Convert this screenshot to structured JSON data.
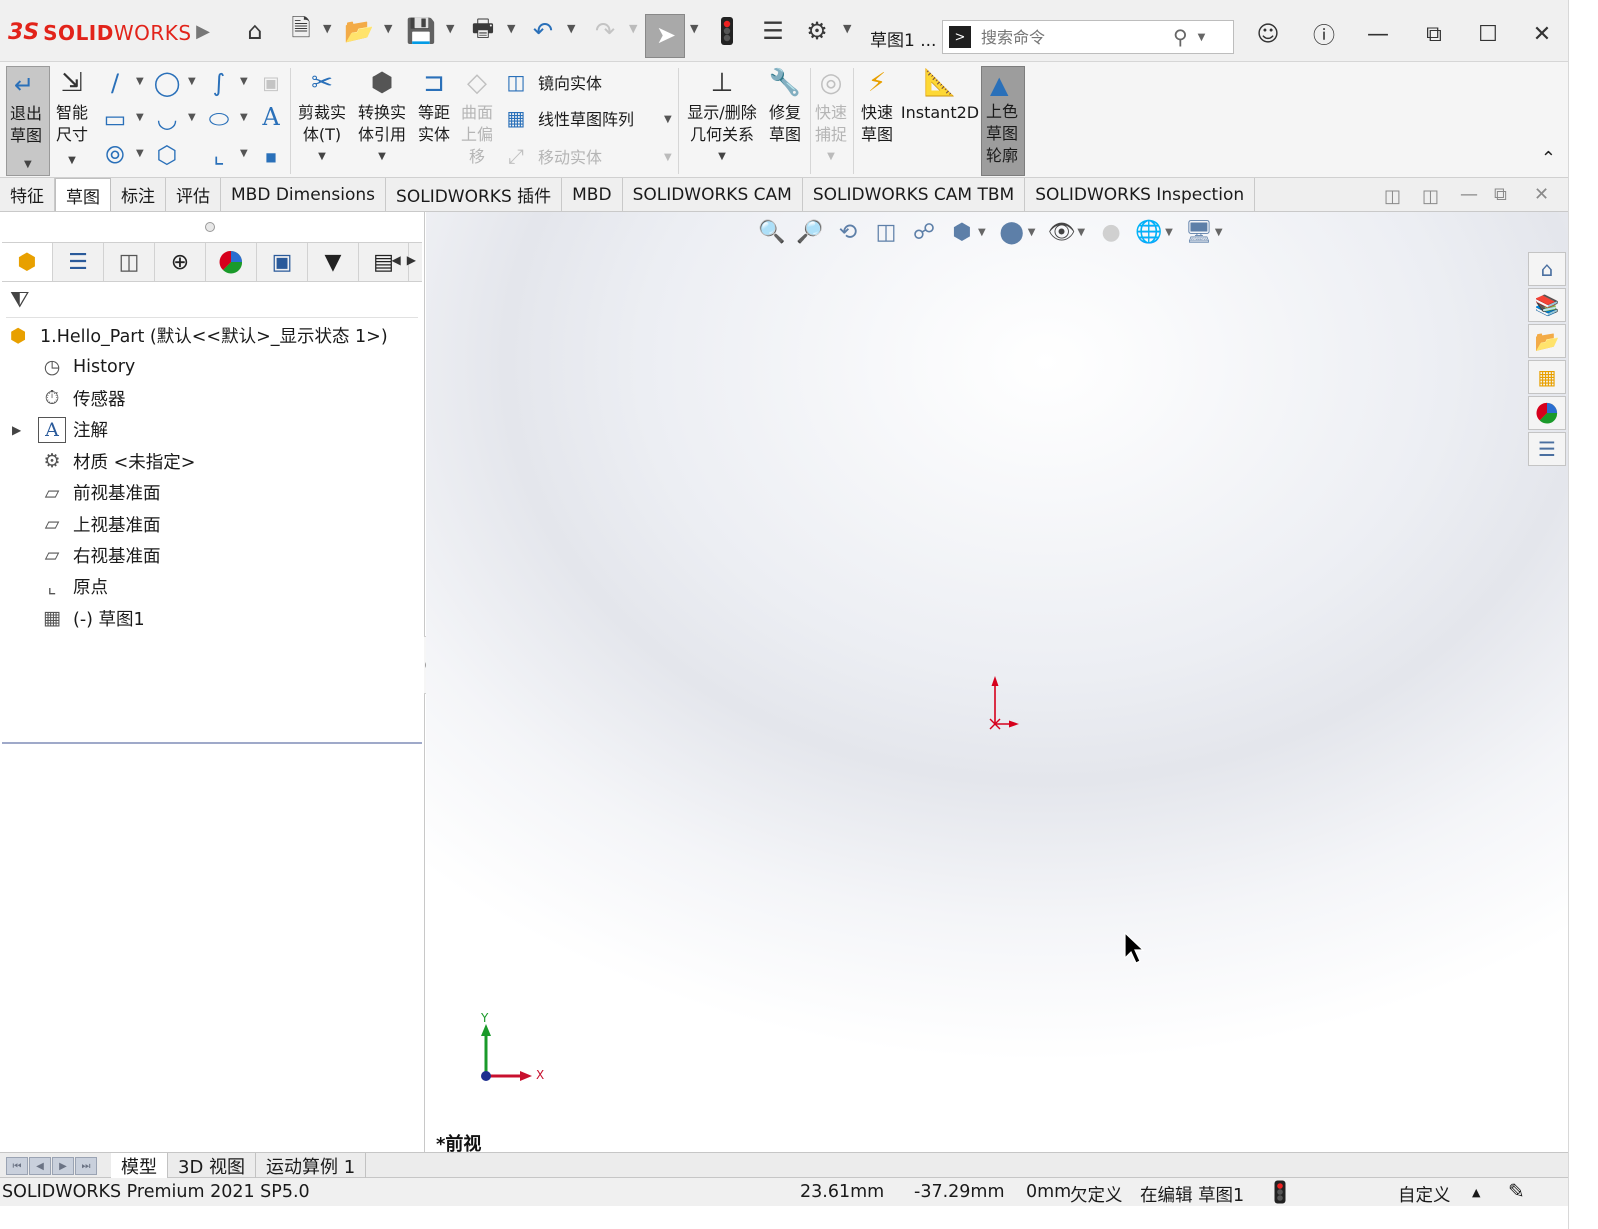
{
  "app": {
    "brand_ds": "3S",
    "brand_solid": "SOLID",
    "brand_works": "WORKS",
    "document_title": "草图1 ...",
    "search_placeholder": "搜索命令"
  },
  "ribbon": {
    "exit_sketch": "退出\n草图",
    "smart_dimension": "智能\n尺寸",
    "trim": "剪裁实\n体(T)",
    "convert": "转换实\n体引用",
    "offset": "等距\n实体",
    "surface_offset": "曲面\n上偏\n移",
    "mirror": "镜向实体",
    "linear_pattern": "线性草图阵列",
    "move": "移动实体",
    "relations": "显示/删除\n几何关系",
    "repair": "修复\n草图",
    "quick_snap": "快速\n捕捉",
    "rapid_sketch": "快速\n草图",
    "instant2d": "Instant2D",
    "shaded_contours": "上色\n草图\n轮廓"
  },
  "command_tabs": [
    "特征",
    "草图",
    "标注",
    "评估",
    "MBD Dimensions",
    "SOLIDWORKS 插件",
    "MBD",
    "SOLIDWORKS CAM",
    "SOLIDWORKS CAM TBM",
    "SOLIDWORKS Inspection"
  ],
  "active_command_tab": "草图",
  "tree": {
    "root": "1.Hello_Part  (默认<<默认>_显示状态 1>)",
    "items": [
      {
        "label": "History",
        "icon": "history-icon"
      },
      {
        "label": "传感器",
        "icon": "sensor-icon"
      },
      {
        "label": "注解",
        "icon": "annotation-icon"
      },
      {
        "label": "材质 <未指定>",
        "icon": "material-icon"
      },
      {
        "label": "前视基准面",
        "icon": "plane-icon"
      },
      {
        "label": "上视基准面",
        "icon": "plane-icon"
      },
      {
        "label": "右视基准面",
        "icon": "plane-icon"
      },
      {
        "label": "原点",
        "icon": "origin-icon"
      },
      {
        "label": "(-) 草图1",
        "icon": "sketch-icon"
      }
    ]
  },
  "graphics": {
    "view_label": "*前视",
    "triad_x": "X",
    "triad_y": "Y"
  },
  "bottom_tabs": [
    "模型",
    "3D 视图",
    "运动算例 1"
  ],
  "status": {
    "product": "SOLIDWORKS Premium 2021 SP5.0",
    "x": "23.61mm",
    "y": "-37.29mm",
    "z": "0mm",
    "definition": "欠定义",
    "editing": "在编辑 草图1",
    "units": "自定义"
  },
  "colors": {
    "brand_red": "#e2231a",
    "tree_underline": "#9fa9c9",
    "origin_red": "#d6001c",
    "triad_green": "#1a9a2a"
  }
}
